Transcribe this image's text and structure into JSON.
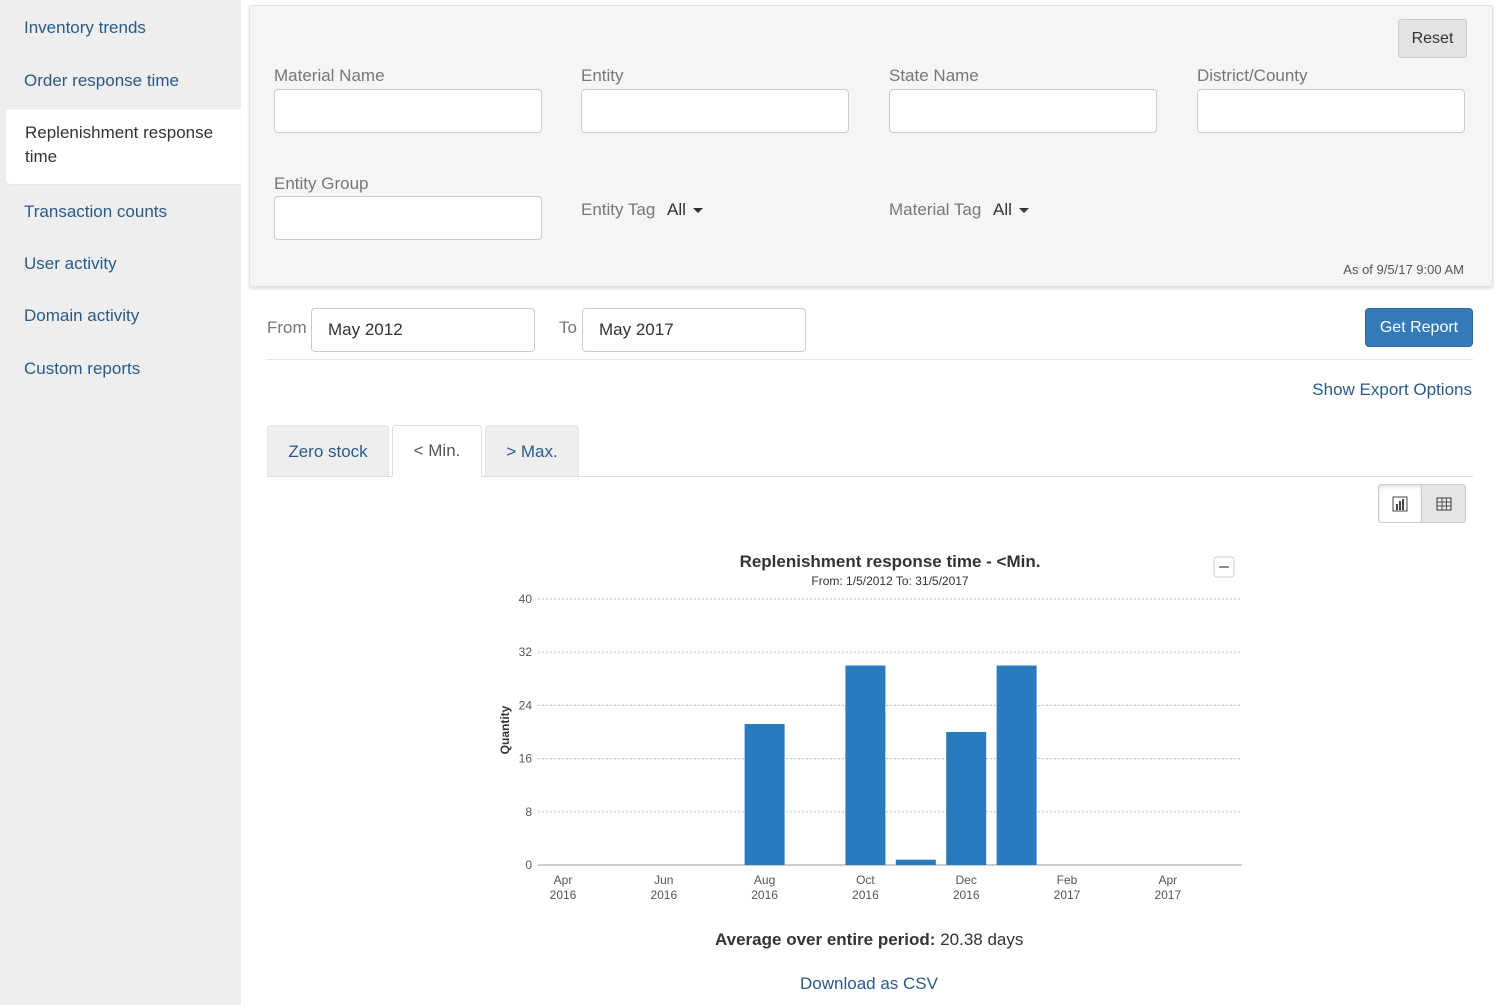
{
  "sidebar": {
    "items": [
      {
        "label": "Inventory trends"
      },
      {
        "label": "Order response time"
      },
      {
        "label": "Replenishment response time"
      },
      {
        "label": "Transaction counts"
      },
      {
        "label": "User activity"
      },
      {
        "label": "Domain activity"
      },
      {
        "label": "Custom reports"
      }
    ],
    "active_index": 2
  },
  "filters": {
    "reset_label": "Reset",
    "material_name_label": "Material Name",
    "entity_label": "Entity",
    "state_name_label": "State Name",
    "district_label": "District/County",
    "entity_group_label": "Entity Group",
    "entity_tag_label": "Entity Tag",
    "entity_tag_value": "All",
    "material_tag_label": "Material Tag",
    "material_tag_value": "All",
    "as_of": "As of 9/5/17 9:00 AM"
  },
  "date_range": {
    "from_label": "From",
    "from_value": "May 2012",
    "to_label": "To",
    "to_value": "May 2017",
    "get_report_label": "Get Report"
  },
  "export_link": "Show Export Options",
  "tabs": [
    {
      "label": "Zero stock"
    },
    {
      "label": "< Min."
    },
    {
      "label": "> Max."
    }
  ],
  "active_tab": 1,
  "view_toggle": {
    "chart_icon": "chart-icon",
    "table_icon": "table-icon"
  },
  "chart_data": {
    "type": "bar",
    "title": "Replenishment response time - <Min.",
    "subtitle": "From: 1/5/2012 To: 31/5/2017",
    "ylabel": "Quantity",
    "xlabel": "",
    "ylim": [
      0,
      40
    ],
    "yticks": [
      0,
      8,
      16,
      24,
      32,
      40
    ],
    "x_ticks": [
      {
        "month": "Apr",
        "year": "2016"
      },
      {
        "month": "Jun",
        "year": "2016"
      },
      {
        "month": "Aug",
        "year": "2016"
      },
      {
        "month": "Oct",
        "year": "2016"
      },
      {
        "month": "Dec",
        "year": "2016"
      },
      {
        "month": "Feb",
        "year": "2017"
      },
      {
        "month": "Apr",
        "year": "2017"
      }
    ],
    "categories": [
      "Aug 2016",
      "Oct 2016",
      "Nov 2016",
      "Dec 2016",
      "Jan 2017"
    ],
    "values": [
      21.2,
      30,
      0.8,
      20,
      30
    ],
    "bar_color": "#2a7abf",
    "grid": true,
    "legend": "none"
  },
  "average_label": "Average over entire period:",
  "average_value": "20.38 days",
  "download_csv": "Download as CSV"
}
